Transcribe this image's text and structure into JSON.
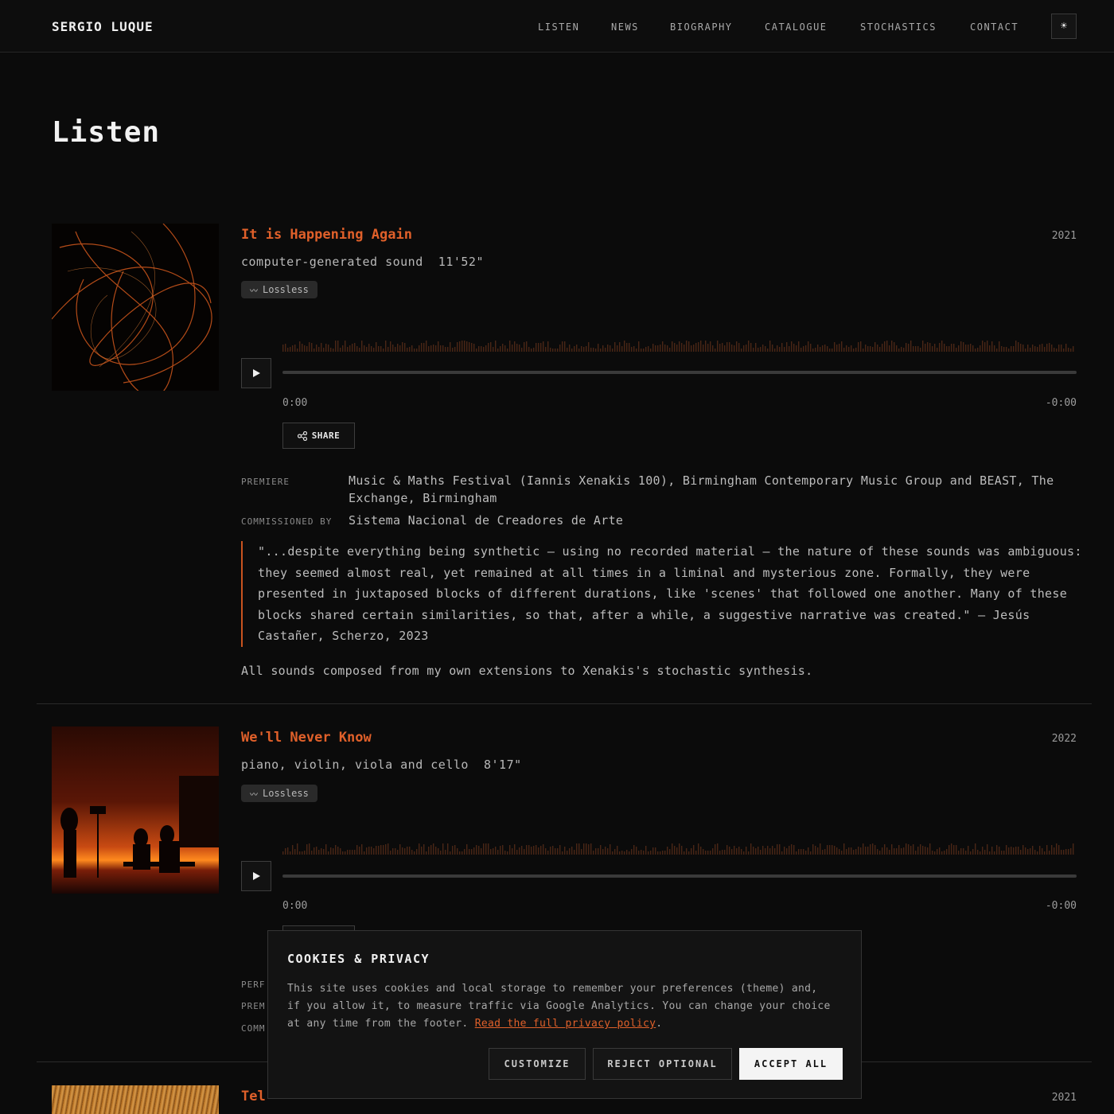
{
  "site": {
    "brand": "SERGIO LUQUE"
  },
  "nav": [
    {
      "label": "LISTEN"
    },
    {
      "label": "NEWS"
    },
    {
      "label": "BIOGRAPHY"
    },
    {
      "label": "CATALOGUE"
    },
    {
      "label": "STOCHASTICS"
    },
    {
      "label": "CONTACT"
    }
  ],
  "theme_toggle": {
    "icon": "sun-icon",
    "glyph": "☀"
  },
  "page": {
    "title": "Listen"
  },
  "colors": {
    "accent": "#e0602a",
    "background": "#0b0b0b"
  },
  "tracks": [
    {
      "title": "It is Happening Again",
      "year": "2021",
      "subtitle": "computer-generated sound  11'52\"",
      "badge": "Lossless",
      "time_start": "0:00",
      "time_end": "-0:00",
      "share": "SHARE",
      "meta": [
        {
          "label": "PREMIERE",
          "value": "Music & Maths Festival (Iannis Xenakis 100), Birmingham Contemporary Music Group and BEAST, The Exchange, Birmingham"
        },
        {
          "label": "COMMISSIONED BY",
          "value": "Sistema Nacional de Creadores de Arte"
        }
      ],
      "quote": "\"...despite everything being synthetic — using no recorded material — the nature of these sounds was ambiguous: they seemed almost real, yet remained at all times in a liminal and mysterious zone. Formally, they were presented in juxtaposed blocks of different durations, like 'scenes' that followed one another. Many of these blocks shared certain similarities, so that, after a while, a suggestive narrative was created.\" — Jesús Castañer, Scherzo, 2023",
      "note": "All sounds composed from my own extensions to Xenakis's stochastic synthesis."
    },
    {
      "title": "We'll Never Know",
      "year": "2022",
      "subtitle": "piano, violin, viola and cello  8'17\"",
      "badge": "Lossless",
      "time_start": "0:00",
      "time_end": "-0:00",
      "meta_labels": [
        "PERF",
        "PREM",
        "COMM"
      ]
    },
    {
      "title": "Tel",
      "year": "2021"
    }
  ],
  "cookie": {
    "title": "COOKIES & PRIVACY",
    "text": "This site uses cookies and local storage to remember your preferences (theme) and, if you allow it, to measure traffic via Google Analytics. You can change your choice at any time from the footer.",
    "link": "Read the full privacy policy",
    "link_suffix": ".",
    "customize": "CUSTOMIZE",
    "reject": "REJECT OPTIONAL",
    "accept": "ACCEPT ALL"
  }
}
